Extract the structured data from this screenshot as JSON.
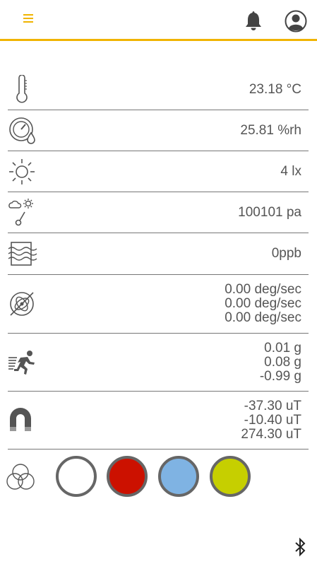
{
  "readings": {
    "temperature": "23.18 °C",
    "humidity": "25.81 %rh",
    "light": "4 lx",
    "pressure": "100101 pa",
    "gas": "0ppb",
    "gyro": [
      "0.00 deg/sec",
      "0.00 deg/sec",
      "0.00 deg/sec"
    ],
    "accel": [
      "0.01 g",
      "0.08 g",
      "-0.99 g"
    ],
    "magnet": [
      "-37.30 uT",
      "-10.40 uT",
      "274.30 uT"
    ]
  },
  "colors": {
    "accent": "#f0b400",
    "swatches": [
      "#ffffff",
      "#cc1100",
      "#7fb3e3",
      "#c6cf00"
    ]
  },
  "icons": [
    "menu-icon",
    "bell-icon",
    "user-icon",
    "thermometer-icon",
    "humidity-gauge-icon",
    "sun-icon",
    "weather-pressure-icon",
    "air-quality-icon",
    "gyroscope-icon",
    "accelerometer-runner-icon",
    "magnet-icon",
    "color-mix-icon",
    "bluetooth-icon"
  ]
}
